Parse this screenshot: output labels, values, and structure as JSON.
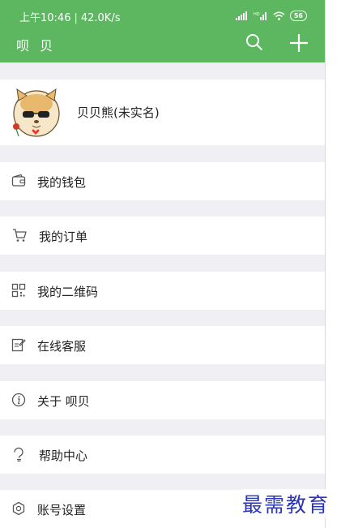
{
  "status_bar": {
    "time": "上午10:46",
    "speed": "42.0K/s",
    "battery": "56"
  },
  "header": {
    "title": "呗 贝"
  },
  "profile": {
    "name": "贝贝熊(未实名)"
  },
  "menu": [
    {
      "label": "我的钱包",
      "icon": "wallet-icon"
    },
    {
      "label": "我的订单",
      "icon": "cart-icon"
    },
    {
      "label": "我的二维码",
      "icon": "qr-code-icon"
    },
    {
      "label": "在线客服",
      "icon": "edit-icon"
    },
    {
      "label": "关于 呗贝",
      "icon": "info-icon"
    },
    {
      "label": "帮助中心",
      "icon": "help-icon"
    },
    {
      "label": "账号设置",
      "icon": "settings-icon"
    }
  ],
  "watermark": "最需教育",
  "colors": {
    "accent": "#5cb760",
    "background": "#efeff4",
    "watermark": "#2b35b8"
  }
}
